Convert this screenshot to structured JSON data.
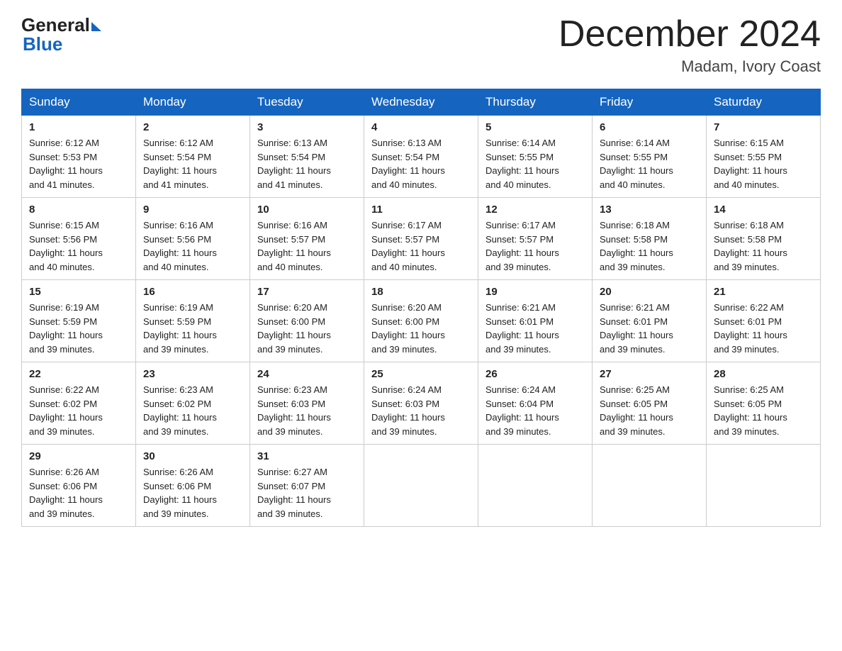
{
  "header": {
    "logo_general": "General",
    "logo_blue": "Blue",
    "month": "December 2024",
    "location": "Madam, Ivory Coast"
  },
  "days_of_week": [
    "Sunday",
    "Monday",
    "Tuesday",
    "Wednesday",
    "Thursday",
    "Friday",
    "Saturday"
  ],
  "weeks": [
    [
      {
        "day": "1",
        "sunrise": "6:12 AM",
        "sunset": "5:53 PM",
        "daylight": "11 hours and 41 minutes."
      },
      {
        "day": "2",
        "sunrise": "6:12 AM",
        "sunset": "5:54 PM",
        "daylight": "11 hours and 41 minutes."
      },
      {
        "day": "3",
        "sunrise": "6:13 AM",
        "sunset": "5:54 PM",
        "daylight": "11 hours and 41 minutes."
      },
      {
        "day": "4",
        "sunrise": "6:13 AM",
        "sunset": "5:54 PM",
        "daylight": "11 hours and 40 minutes."
      },
      {
        "day": "5",
        "sunrise": "6:14 AM",
        "sunset": "5:55 PM",
        "daylight": "11 hours and 40 minutes."
      },
      {
        "day": "6",
        "sunrise": "6:14 AM",
        "sunset": "5:55 PM",
        "daylight": "11 hours and 40 minutes."
      },
      {
        "day": "7",
        "sunrise": "6:15 AM",
        "sunset": "5:55 PM",
        "daylight": "11 hours and 40 minutes."
      }
    ],
    [
      {
        "day": "8",
        "sunrise": "6:15 AM",
        "sunset": "5:56 PM",
        "daylight": "11 hours and 40 minutes."
      },
      {
        "day": "9",
        "sunrise": "6:16 AM",
        "sunset": "5:56 PM",
        "daylight": "11 hours and 40 minutes."
      },
      {
        "day": "10",
        "sunrise": "6:16 AM",
        "sunset": "5:57 PM",
        "daylight": "11 hours and 40 minutes."
      },
      {
        "day": "11",
        "sunrise": "6:17 AM",
        "sunset": "5:57 PM",
        "daylight": "11 hours and 40 minutes."
      },
      {
        "day": "12",
        "sunrise": "6:17 AM",
        "sunset": "5:57 PM",
        "daylight": "11 hours and 39 minutes."
      },
      {
        "day": "13",
        "sunrise": "6:18 AM",
        "sunset": "5:58 PM",
        "daylight": "11 hours and 39 minutes."
      },
      {
        "day": "14",
        "sunrise": "6:18 AM",
        "sunset": "5:58 PM",
        "daylight": "11 hours and 39 minutes."
      }
    ],
    [
      {
        "day": "15",
        "sunrise": "6:19 AM",
        "sunset": "5:59 PM",
        "daylight": "11 hours and 39 minutes."
      },
      {
        "day": "16",
        "sunrise": "6:19 AM",
        "sunset": "5:59 PM",
        "daylight": "11 hours and 39 minutes."
      },
      {
        "day": "17",
        "sunrise": "6:20 AM",
        "sunset": "6:00 PM",
        "daylight": "11 hours and 39 minutes."
      },
      {
        "day": "18",
        "sunrise": "6:20 AM",
        "sunset": "6:00 PM",
        "daylight": "11 hours and 39 minutes."
      },
      {
        "day": "19",
        "sunrise": "6:21 AM",
        "sunset": "6:01 PM",
        "daylight": "11 hours and 39 minutes."
      },
      {
        "day": "20",
        "sunrise": "6:21 AM",
        "sunset": "6:01 PM",
        "daylight": "11 hours and 39 minutes."
      },
      {
        "day": "21",
        "sunrise": "6:22 AM",
        "sunset": "6:01 PM",
        "daylight": "11 hours and 39 minutes."
      }
    ],
    [
      {
        "day": "22",
        "sunrise": "6:22 AM",
        "sunset": "6:02 PM",
        "daylight": "11 hours and 39 minutes."
      },
      {
        "day": "23",
        "sunrise": "6:23 AM",
        "sunset": "6:02 PM",
        "daylight": "11 hours and 39 minutes."
      },
      {
        "day": "24",
        "sunrise": "6:23 AM",
        "sunset": "6:03 PM",
        "daylight": "11 hours and 39 minutes."
      },
      {
        "day": "25",
        "sunrise": "6:24 AM",
        "sunset": "6:03 PM",
        "daylight": "11 hours and 39 minutes."
      },
      {
        "day": "26",
        "sunrise": "6:24 AM",
        "sunset": "6:04 PM",
        "daylight": "11 hours and 39 minutes."
      },
      {
        "day": "27",
        "sunrise": "6:25 AM",
        "sunset": "6:05 PM",
        "daylight": "11 hours and 39 minutes."
      },
      {
        "day": "28",
        "sunrise": "6:25 AM",
        "sunset": "6:05 PM",
        "daylight": "11 hours and 39 minutes."
      }
    ],
    [
      {
        "day": "29",
        "sunrise": "6:26 AM",
        "sunset": "6:06 PM",
        "daylight": "11 hours and 39 minutes."
      },
      {
        "day": "30",
        "sunrise": "6:26 AM",
        "sunset": "6:06 PM",
        "daylight": "11 hours and 39 minutes."
      },
      {
        "day": "31",
        "sunrise": "6:27 AM",
        "sunset": "6:07 PM",
        "daylight": "11 hours and 39 minutes."
      },
      null,
      null,
      null,
      null
    ]
  ],
  "labels": {
    "sunrise": "Sunrise:",
    "sunset": "Sunset:",
    "daylight": "Daylight:"
  }
}
